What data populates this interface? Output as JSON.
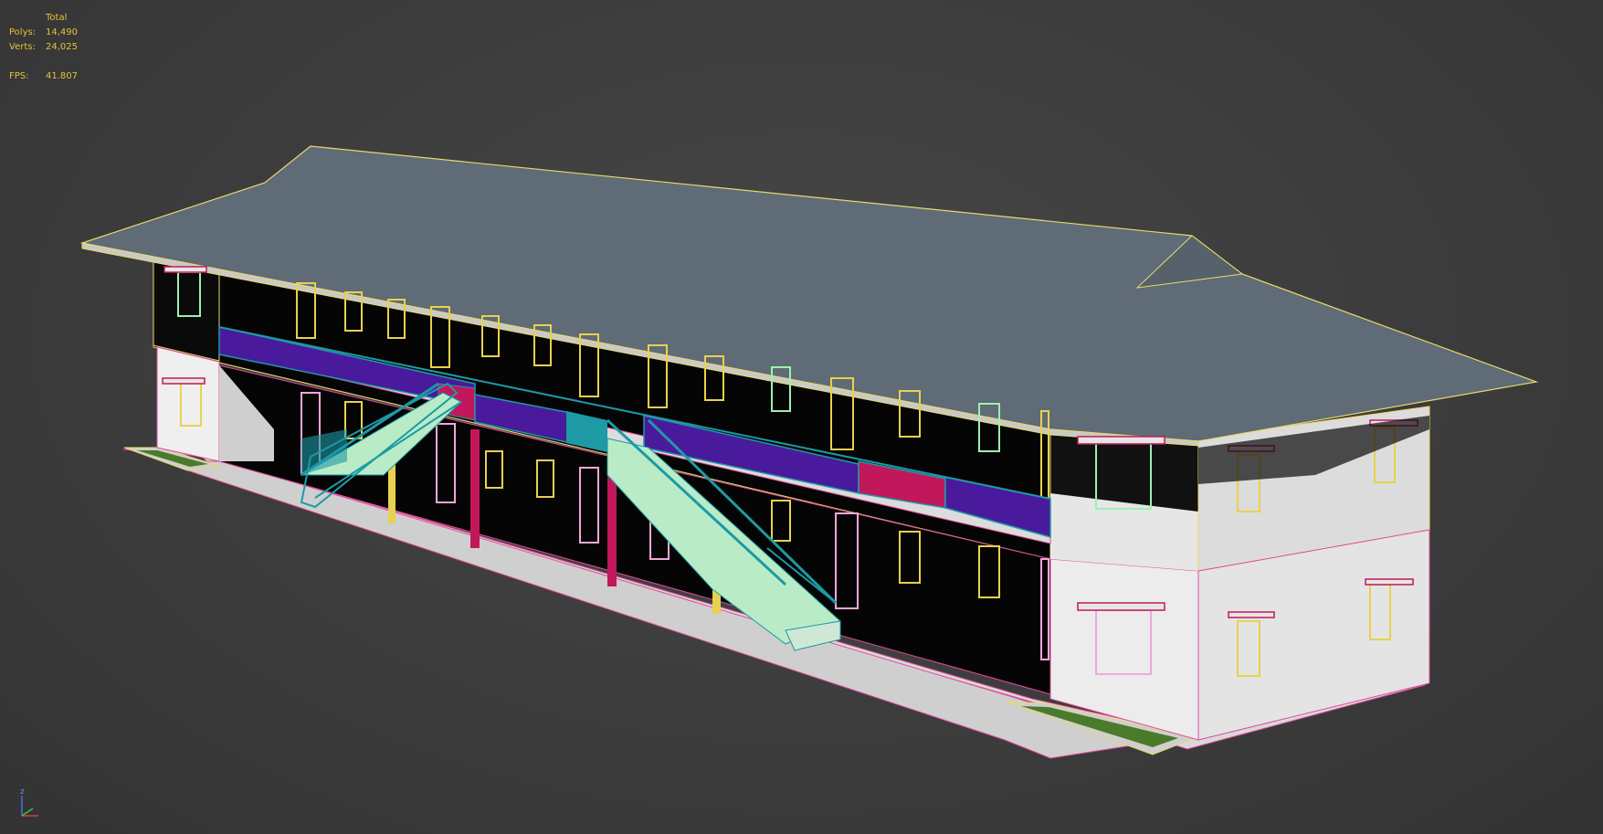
{
  "viewport": {
    "background": "#3c3c3c",
    "statistics": {
      "header": "Total",
      "rows": [
        {
          "label": "Polys:",
          "value": "14,490"
        },
        {
          "label": "Verts:",
          "value": "24,025"
        }
      ],
      "fps_label": "FPS:",
      "fps_value": "41.807",
      "color": "#e4c23a"
    },
    "axis_gizmo": {
      "z_label": "z",
      "icon": "axis-tripod-icon"
    }
  },
  "scene": {
    "object": "two-storey-building-model",
    "colors": {
      "roof": "#5f6b76",
      "roof_edge": "#e8d96a",
      "wall": "#f2f2f2",
      "wall_dark": "#050505",
      "railing_purple": "#4a1a9c",
      "railing_teal": "#1d9aa6",
      "railing_red": "#c2185b",
      "stair": "#b9ecc6",
      "window_yellow": "#e8d14f",
      "window_green": "#9ef0b0",
      "window_pink": "#f0a8d8",
      "column_red": "#c2185b",
      "column_yellow": "#e8d14f",
      "planter": "#4a7a2a"
    }
  }
}
